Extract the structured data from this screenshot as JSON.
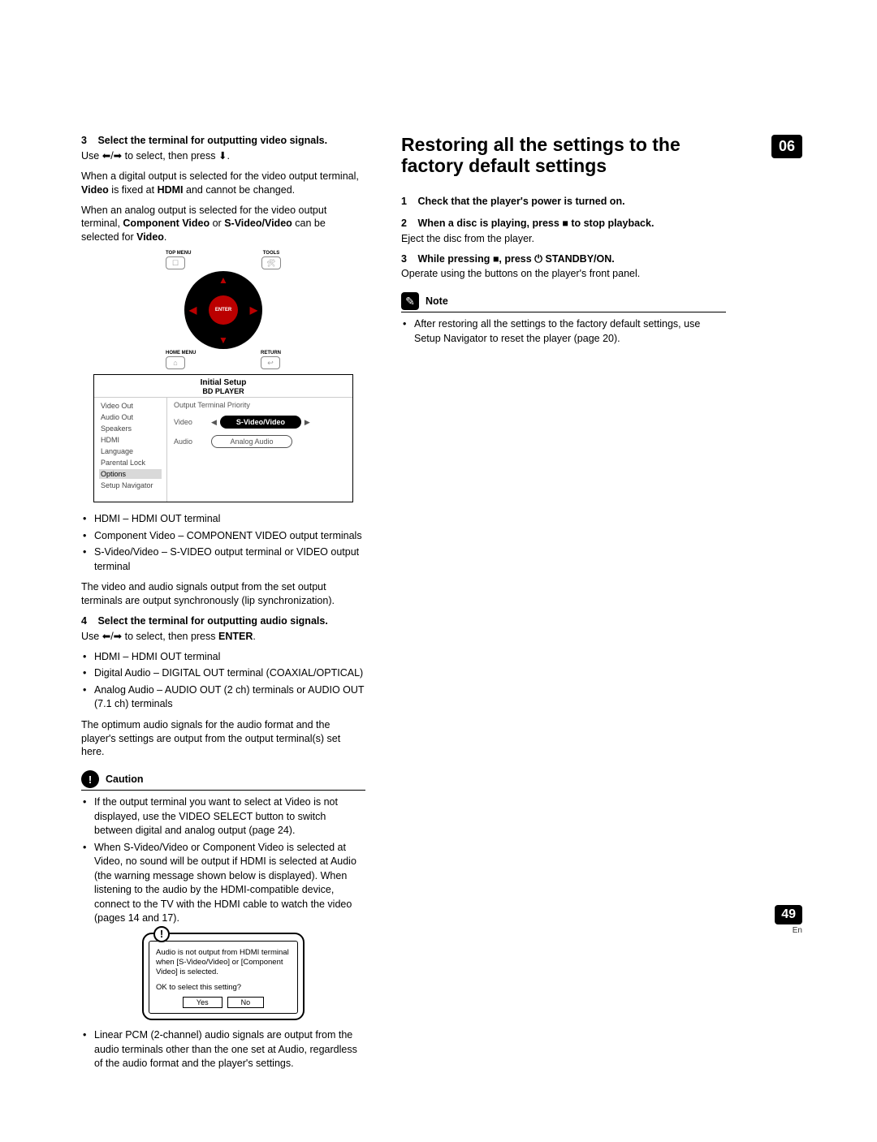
{
  "chapter_badge": "06",
  "page_number": "49",
  "page_lang": "En",
  "left": {
    "step3_num": "3",
    "step3_title": "Select the terminal for outputting video signals.",
    "step3_use_prefix": "Use ",
    "step3_use_mid": " to select, then press ",
    "step3_use_suffix": ".",
    "para1_a": "When a digital output is selected for the video output terminal, ",
    "para1_b": "Video",
    "para1_c": " is fixed at ",
    "para1_d": "HDMI",
    "para1_e": " and cannot be changed.",
    "para2_a": "When an analog output is selected for the video output terminal, ",
    "para2_b": "Component Video",
    "para2_c": " or ",
    "para2_d": "S-Video/Video",
    "para2_e": " can be selected for ",
    "para2_f": "Video",
    "para2_g": ".",
    "remote": {
      "top_menu": "TOP MENU",
      "tools": "TOOLS",
      "enter": "ENTER",
      "home_menu": "HOME MENU",
      "return": "RETURN"
    },
    "osd": {
      "header1": "Initial Setup",
      "header2": "BD PLAYER",
      "left_items": [
        "Video Out",
        "Audio Out",
        "Speakers",
        "HDMI",
        "Language",
        "Parental Lock",
        "Options",
        "Setup Navigator"
      ],
      "selected_index": 6,
      "right_title": "Output Terminal Priority",
      "video_label": "Video",
      "video_value": "S-Video/Video",
      "audio_label": "Audio",
      "audio_value": "Analog Audio"
    },
    "terms_video": [
      {
        "b1": "HDMI",
        "t1": " – ",
        "b2": "HDMI OUT",
        "t2": " terminal"
      },
      {
        "b1": "Component Video",
        "t1": " – ",
        "b2": "COMPONENT VIDEO",
        "t2": " output terminals"
      },
      {
        "b1": "S-Video/Video",
        "t1": " – ",
        "b2": "S-VIDEO",
        "t2": " output terminal or ",
        "b3": "VIDEO",
        "t3": " output terminal"
      }
    ],
    "para3": "The video and audio signals output from the set output terminals are output synchronously (lip synchronization).",
    "step4_num": "4",
    "step4_title": "Select the terminal for outputting audio signals.",
    "step4_use_prefix": "Use ",
    "step4_use_mid": " to select, then press ",
    "step4_enter": "ENTER",
    "step4_use_suffix": ".",
    "terms_audio": [
      {
        "b1": "HDMI",
        "t1": " – ",
        "b2": "HDMI OUT",
        "t2": " terminal"
      },
      {
        "b1": "Digital Audio",
        "t1": " – ",
        "b2": "DIGITAL OUT",
        "t2": " terminal (",
        "b3": "COAXIAL",
        "t3": "/",
        "b4": "OPTICAL",
        "t4": ")"
      },
      {
        "b1": "Analog Audio",
        "t1": " – ",
        "b2": "AUDIO OUT (2 ch)",
        "t2": " terminals or ",
        "b3": "AUDIO OUT (7.1 ch)",
        "t3": " terminals"
      }
    ],
    "para4": "The optimum audio signals for the audio format and the player's settings are output from the output terminal(s) set here.",
    "caution_label": "Caution",
    "caution_items": [
      {
        "pre": "If the output terminal you want to select at ",
        "b1": "Video",
        "mid1": " is not displayed, use the ",
        "b2": "VIDEO SELECT",
        "post": " button to switch between digital and analog output (page 24)."
      },
      {
        "pre": "When ",
        "b1": "S-Video/Video",
        "mid1": " or ",
        "b2": "Component Video",
        "mid2": " is selected at ",
        "b3": "Video",
        "mid3": ", no sound will be output if ",
        "b4": "HDMI",
        "mid4": " is selected at ",
        "b5": "Audio",
        "post": " (the warning message shown below is displayed). When listening to the audio by the HDMI-compatible device, connect to the TV with the HDMI cable to watch the video (pages 14 and 17)."
      }
    ],
    "warn": {
      "text": "Audio is not output from HDMI terminal when [S-Video/Video] or [Component Video] is selected.",
      "question": "OK to select this setting?",
      "yes": "Yes",
      "no": "No"
    },
    "pcm_pre": "Linear PCM (2-channel) audio signals are output from the audio terminals other than the one set at ",
    "pcm_b": "Audio",
    "pcm_post": ", regardless of the audio format and the player's settings."
  },
  "right": {
    "heading": "Restoring all the settings to the factory default settings",
    "step1_num": "1",
    "step1_title": "Check that the player's power is turned on.",
    "step2_num": "2",
    "step2_title_a": "When a disc is playing, press ",
    "step2_title_b": " to stop playback.",
    "step2_body": "Eject the disc from the player.",
    "step3_num": "3",
    "step3_title_a": "While pressing ",
    "step3_title_b": ", press ",
    "step3_title_c": " STANDBY/ON.",
    "step3_body": "Operate using the buttons on the player's front panel.",
    "note_label": "Note",
    "note_item": "After restoring all the settings to the factory default settings, use Setup Navigator to reset the player (page 20)."
  }
}
